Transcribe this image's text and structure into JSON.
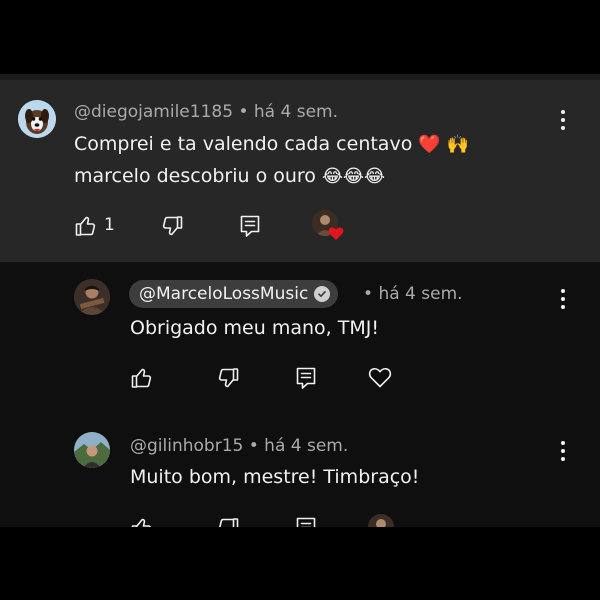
{
  "comment": {
    "author": "@diegojamile1185",
    "separator": "•",
    "time": "há 4 sem.",
    "line1": "Comprei e ta valendo cada centavo",
    "line1_emoji": "❤️ 🙌",
    "line2": "marcelo descobriu o ouro",
    "line2_emoji": "😂😂😂",
    "like_count": "1",
    "icons": [
      "thumbs-up-icon",
      "thumbs-down-icon",
      "reply-icon",
      "creator-heart-icon",
      "more-icon"
    ]
  },
  "replies": [
    {
      "author": "@MarceloLossMusic",
      "verified": true,
      "time": "há 4 sem.",
      "text": "Obrigado meu mano, TMJ!"
    },
    {
      "author": "@gilinhobr15",
      "verified": false,
      "time": "há 4 sem.",
      "text": "Muito bom, mestre! Timbraço!"
    }
  ],
  "colors": {
    "main_bg": "#272727",
    "reply_bg": "#0f0f0f",
    "meta_text": "#aaaaaa",
    "heart": "#e5131d"
  }
}
